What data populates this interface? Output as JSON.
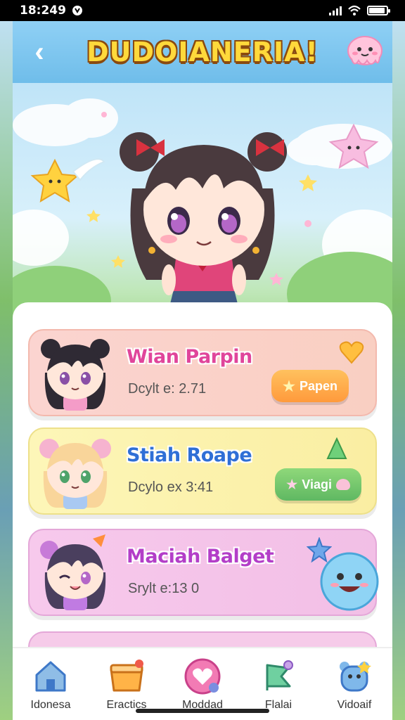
{
  "status_bar": {
    "time": "18:249",
    "time_icon": "status-glyph-icon"
  },
  "header": {
    "title": "DUDOIANERIA!",
    "back_icon": "back-chevron-icon",
    "mascot": "pink-ghost-icon"
  },
  "colors": {
    "header": "#6fbdea",
    "title": "#ffd93b",
    "accent_pink": "#e0459b"
  },
  "cards": [
    {
      "name": "Wian Parpin",
      "subtitle": "Dcylt e: 2.71",
      "action_label": "Papen",
      "action_icon": "star-icon",
      "theme": "pink"
    },
    {
      "name": "Stiah Roape",
      "subtitle": "Dcylo ex 3:41",
      "action_label": "Viagi",
      "action_icon": "star-icon",
      "theme": "yellow"
    },
    {
      "name": "Maciah Balget",
      "subtitle": "Srylt e:13 0",
      "theme": "purple",
      "decor_icon": "smiley-bubble-icon"
    }
  ],
  "nav": [
    {
      "label": "Idonesa",
      "icon": "house-icon"
    },
    {
      "label": "Eractics",
      "icon": "box-icon"
    },
    {
      "label": "Moddad",
      "icon": "heart-icon"
    },
    {
      "label": "Flalai",
      "icon": "flag-icon"
    },
    {
      "label": "Vidoaif",
      "icon": "bear-icon"
    }
  ]
}
